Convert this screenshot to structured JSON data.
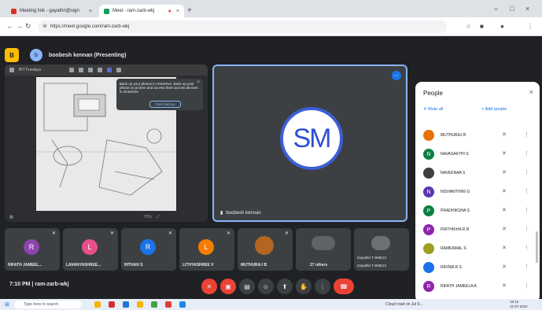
{
  "browser": {
    "tabs": [
      {
        "label": "Meeting link - gayathri@sign",
        "fav_color": "#d93025"
      },
      {
        "label": "Meet - ram-zarb-wkj",
        "fav_color": "#0f9d58"
      }
    ],
    "url": "https://meet.google.com/ram-zarb-wkj"
  },
  "meet": {
    "presenter_bar": {
      "icon_label": "B",
      "avatar": "b",
      "title": "boobesh kennan (Presenting)"
    },
    "share_tile": {
      "toolbar_text": "BIT Fundays",
      "popup_text": "Back up your photos in OneDrive. Back up your photos to protect and access them across devices in OneDrive.",
      "popup_button": "Start backup",
      "footer_zoom": "70%"
    },
    "sm_tile": {
      "initials": "SM",
      "name": "boobesh kennan"
    },
    "thumbnails": [
      {
        "initial": "R",
        "color": "#8e44ad",
        "name": "RIFATH JAMEEL..."
      },
      {
        "initial": "L",
        "color": "#e84f8a",
        "name": "LAVANYASHREE..."
      },
      {
        "initial": "R",
        "color": "#1a73e8",
        "name": "RITHAN S"
      },
      {
        "initial": "L",
        "color": "#f57c00",
        "name": "LITHYASHREE V"
      },
      {
        "initial": "",
        "color": "#b4651f",
        "name": "MUTHURAJ B"
      },
      {
        "initial": "",
        "color": "#5f6368",
        "name": "27 others"
      },
      {
        "initial": "",
        "color": "#5f6368",
        "name": "Gayathri T BME13",
        "sub": "Gayathri T BME13"
      }
    ],
    "controls": {
      "time": "7:10 PM",
      "separator": "|",
      "code": "ram-zarb-wkj"
    }
  },
  "people": {
    "title": "People",
    "mute_all": "Mute all",
    "add_people": "Add people",
    "list": [
      {
        "name": "MUTHURAJ B",
        "initial": "",
        "color": "#e8710a"
      },
      {
        "name": "NAVASAKTHI S",
        "initial": "N",
        "color": "#0b8043"
      },
      {
        "name": "NAVEENAA S",
        "initial": "",
        "color": "#3c4043"
      },
      {
        "name": "NISHANTHINI G",
        "initial": "N",
        "color": "#5e35b1"
      },
      {
        "name": "PRADHIKSHA S",
        "initial": "P",
        "color": "#0b8043"
      },
      {
        "name": "PRITHIKHA R R",
        "initial": "P",
        "color": "#8e24aa"
      },
      {
        "name": "RAMKAMAL S",
        "initial": "",
        "color": "#9e9d24"
      },
      {
        "name": "RAYMA R S",
        "initial": "",
        "color": "#1a73e8"
      },
      {
        "name": "RIFATH JAMEELA A",
        "initial": "R",
        "color": "#8e24aa"
      }
    ]
  },
  "taskbar": {
    "search_placeholder": "Type here to search",
    "weather": "Cloud road on Jul 9...",
    "clock_time": "19:10",
    "clock_date": "11-07-2024"
  }
}
